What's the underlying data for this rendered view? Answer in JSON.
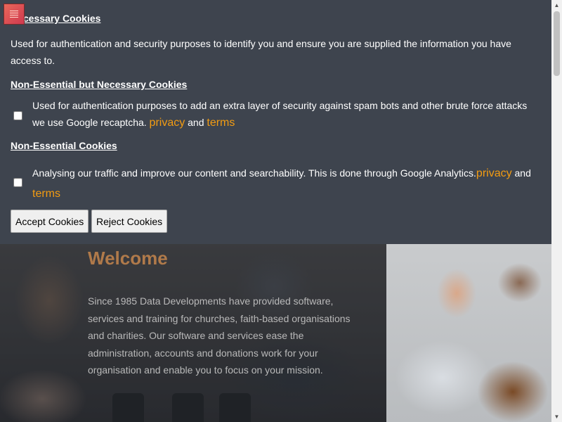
{
  "cookie_banner": {
    "necessary": {
      "heading": "Necessary Cookies",
      "text": "Used for authentication and security purposes to identify you and ensure you are supplied the information you have access to."
    },
    "non_essential_necessary": {
      "heading": "Non-Essential but Necessary Cookies",
      "text": "Used for authentication purposes to add an extra layer of security against spam bots and other brute force attacks we use Google recaptcha.",
      "privacy_link": "privacy",
      "and": "and",
      "terms_link": "terms",
      "checked": false
    },
    "non_essential": {
      "heading": "Non-Essential Cookies",
      "text": "Analysing our traffic and improve our content and searchability. This is done through Google Analytics.",
      "privacy_link": "privacy",
      "and": "and",
      "terms_link": "terms",
      "checked": false
    },
    "accept_label": "Accept Cookies",
    "reject_label": "Reject Cookies",
    "link_color": "#f39c12",
    "panel_color": "#3e444e"
  },
  "menu_toggle": {
    "icon": "hamburger-menu-icon",
    "color": "#e05a4f"
  },
  "hero": {
    "title": "Welcome",
    "text": "Since 1985 Data Developments have provided software, services and training for churches, faith-based organisations and charities. Our software and services ease the administration, accounts and donations work for your organisation and enable you to focus on your mission.",
    "title_color": "#b07a4a"
  },
  "scrollbar": {
    "up_icon": "scroll-up-arrow-icon",
    "down_icon": "scroll-down-arrow-icon"
  }
}
